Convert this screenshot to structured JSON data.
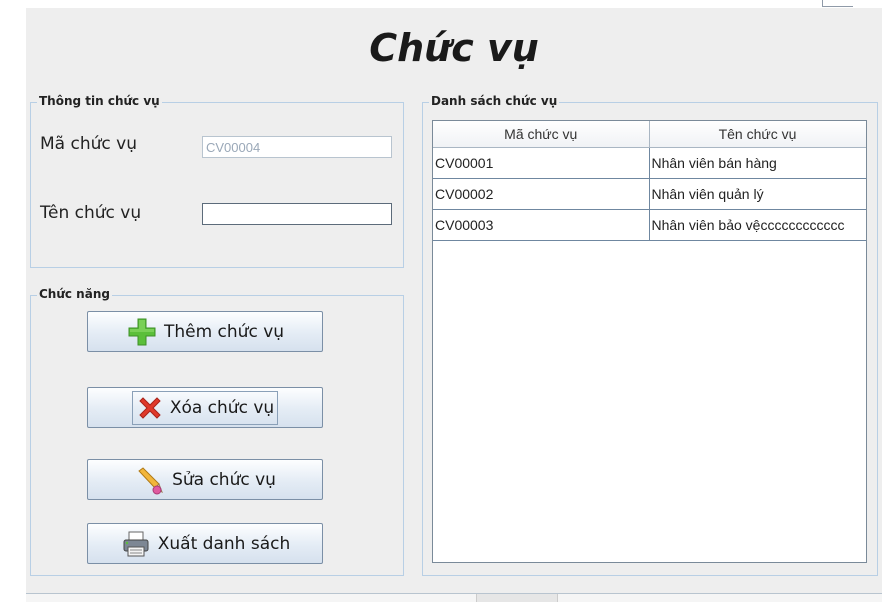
{
  "window": {
    "title": "Chức vụ"
  },
  "info_group": {
    "legend": "Thông tin chức vụ",
    "code_label": "Mã chức vụ",
    "code_value": "CV00004",
    "name_label": "Tên chức vụ",
    "name_value": ""
  },
  "functions_group": {
    "legend": "Chức năng",
    "buttons": [
      {
        "label": "Thêm chức vụ",
        "icon": "plus-icon"
      },
      {
        "label": "Xóa chức vụ",
        "icon": "delete-x-icon"
      },
      {
        "label": "Sửa chức vụ",
        "icon": "pencil-icon"
      },
      {
        "label": "Xuất danh sách",
        "icon": "printer-icon"
      }
    ]
  },
  "list_group": {
    "legend": "Danh sách chức vụ",
    "columns": [
      "Mã chức vụ",
      "Tên chức vụ"
    ],
    "rows": [
      [
        "CV00001",
        "Nhân viên bán hàng"
      ],
      [
        "CV00002",
        "Nhân viên quản lý"
      ],
      [
        "CV00003",
        "Nhân viên bảo vệcccccccccccc"
      ]
    ]
  },
  "colors": {
    "background": "#eeeeee",
    "group_border": "#b8cfe5",
    "plus_green": "#5bbf3a",
    "delete_red": "#e0392b"
  }
}
